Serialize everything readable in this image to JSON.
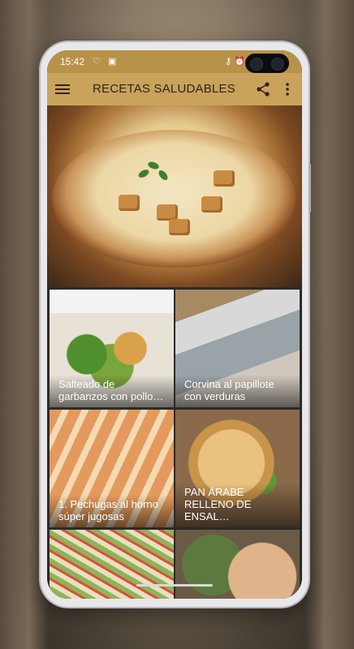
{
  "status_bar": {
    "time": "15:42",
    "left_icons": [
      "heart-shield-icon",
      "download-box-icon"
    ],
    "right_icons": [
      "key-icon",
      "alarm-icon"
    ]
  },
  "app_bar": {
    "title": "RECETAS SALUDABLES",
    "icons": [
      "menu-icon",
      "share-icon",
      "more-vert-icon"
    ]
  },
  "colors": {
    "status_bar": "#b9924a",
    "app_bar": "#c9a35c",
    "grid_bg": "#2a2a2a"
  },
  "hero": {
    "image": "creamy-soup-bowl"
  },
  "recipes": [
    {
      "title": "Salteado de garbanzos con pollo…",
      "image": "chickpea-broccoli-salad"
    },
    {
      "title": "Corvina al papillote con verduras",
      "image": "fish-in-foil"
    },
    {
      "title": "1. Pechugas al horno súper jugosas",
      "image": "sliced-chicken-breast"
    },
    {
      "title": "PAN ÁRABE RELLENO DE ENSAL…",
      "image": "stuffed-pita"
    },
    {
      "title": "",
      "image": "shredded-salad"
    },
    {
      "title": "",
      "image": "stuffed-bread"
    }
  ]
}
